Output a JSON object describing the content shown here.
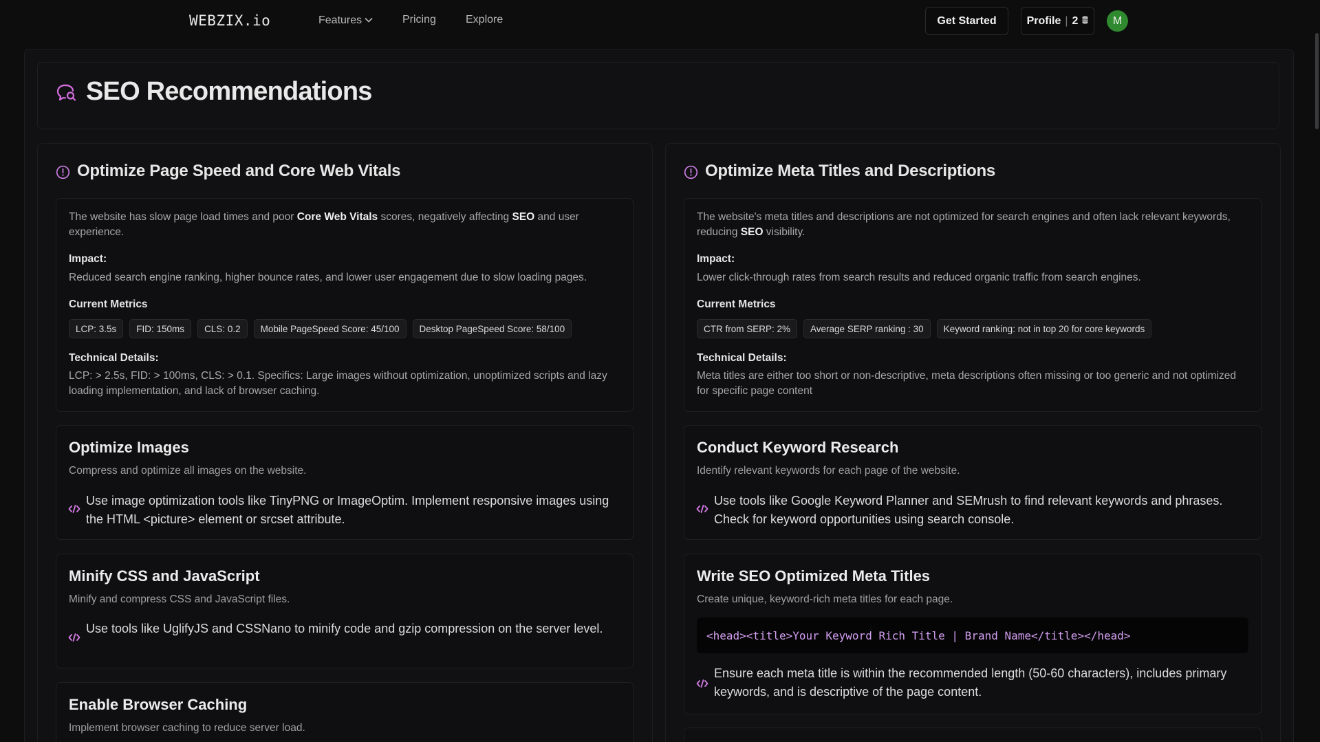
{
  "nav": {
    "logo": "WEBZIX.io",
    "links": [
      "Features",
      "Pricing",
      "Explore"
    ],
    "get_started": "Get Started",
    "profile_label": "Profile",
    "profile_count": "2",
    "avatar_initial": "M"
  },
  "page": {
    "title": "SEO Recommendations"
  },
  "left": {
    "title": "Optimize Page Speed and Core Web Vitals",
    "desc_a": "The website has slow page load times and poor ",
    "desc_b": "Core Web Vitals",
    "desc_c": " scores, negatively affecting ",
    "desc_d": "SEO",
    "desc_e": " and user experience.",
    "impact_label": "Impact:",
    "impact": "Reduced search engine ranking, higher bounce rates, and lower user engagement due to slow loading pages.",
    "metrics_label": "Current Metrics",
    "metrics": [
      "LCP: 3.5s",
      "FID: 150ms",
      "CLS: 0.2",
      "Mobile PageSpeed Score: 45/100",
      "Desktop PageSpeed Score: 58/100"
    ],
    "tech_label": "Technical Details:",
    "tech": "LCP: > 2.5s, FID: > 100ms, CLS: > 0.1. Specifics: Large images without optimization, unoptimized scripts and lazy loading implementation, and lack of browser caching.",
    "recs": [
      {
        "title": "Optimize Images",
        "sub": "Compress and optimize all images on the website.",
        "body": "Use image optimization tools like TinyPNG or ImageOptim. Implement responsive images using the HTML <picture> element or srcset attribute."
      },
      {
        "title": "Minify CSS and JavaScript",
        "sub": "Minify and compress CSS and JavaScript files.",
        "body": "Use tools like UglifyJS and CSSNano to minify code and gzip compression on the server level."
      },
      {
        "title": "Enable Browser Caching",
        "sub": "Implement browser caching to reduce server load."
      }
    ]
  },
  "right": {
    "title": "Optimize Meta Titles and Descriptions",
    "desc_a": "The website's meta titles and descriptions are not optimized for search engines and often lack relevant keywords, reducing ",
    "desc_b": "SEO",
    "desc_c": " visibility.",
    "impact_label": "Impact:",
    "impact": "Lower click-through rates from search results and reduced organic traffic from search engines.",
    "metrics_label": "Current Metrics",
    "metrics": [
      "CTR from SERP: 2%",
      "Average SERP ranking : 30",
      "Keyword ranking: not in top 20 for core keywords"
    ],
    "tech_label": "Technical Details:",
    "tech": "Meta titles are either too short or non-descriptive, meta descriptions often missing or too generic and not optimized for specific page content",
    "recs": [
      {
        "title": "Conduct Keyword Research",
        "sub": "Identify relevant keywords for each page of the website.",
        "body": "Use tools like Google Keyword Planner and SEMrush to find relevant keywords and phrases. Check for keyword opportunities using search console."
      },
      {
        "title": "Write SEO Optimized Meta Titles",
        "sub": "Create unique, keyword-rich meta titles for each page.",
        "code": "<head><title>Your Keyword Rich Title | Brand Name</title></head>",
        "body": "Ensure each meta title is within the recommended length (50-60 characters), includes primary keywords, and is descriptive of the page content."
      }
    ]
  }
}
